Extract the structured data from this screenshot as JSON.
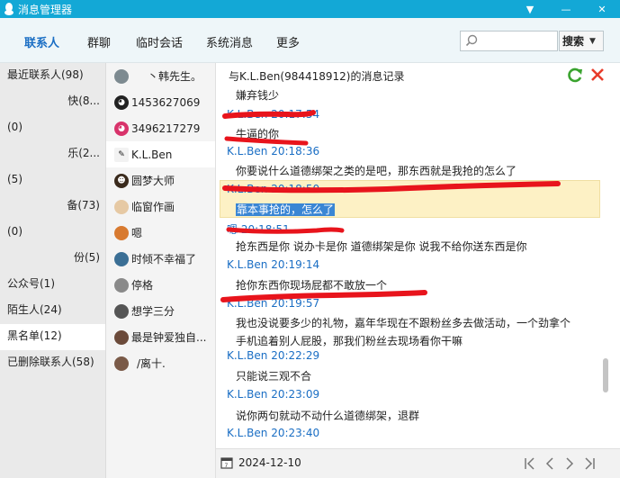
{
  "window": {
    "title": "消息管理器",
    "buttons": [
      "▼",
      "—",
      "✕"
    ]
  },
  "nav": {
    "tabs": [
      "联系人",
      "群聊",
      "临时会话",
      "系统消息",
      "更多"
    ],
    "active": 0
  },
  "search": {
    "placeholder": "",
    "button_label": "搜索"
  },
  "categories": [
    {
      "label": "最近联系人(98)"
    },
    {
      "label": "快(8..."
    },
    {
      "label": "(0)"
    },
    {
      "label": "乐(2..."
    },
    {
      "label": "(5)"
    },
    {
      "label": "备(73)"
    },
    {
      "label": "(0)"
    },
    {
      "label": "份(5)"
    },
    {
      "label": "公众号(1)"
    },
    {
      "label": "陌生人(24)"
    },
    {
      "label": "黑名单(12)"
    },
    {
      "label": "已删除联系人(58)"
    }
  ],
  "contacts": [
    {
      "name": "丶韩先生。"
    },
    {
      "name": "1453627069"
    },
    {
      "name": "3496217279"
    },
    {
      "name": "K.L.Ben"
    },
    {
      "name": "圆梦大师"
    },
    {
      "name": "临窗作画"
    },
    {
      "name": "嗯"
    },
    {
      "name": "时倾不幸福了"
    },
    {
      "name": "停格"
    },
    {
      "name": "想学三分"
    },
    {
      "name": "最是钟爱独自..."
    },
    {
      "name": "/离十."
    }
  ],
  "record": {
    "title": "与K.L.Ben(984418912)的消息记录",
    "items": [
      {
        "kind": "msg",
        "text": "嫌弃钱少"
      },
      {
        "kind": "meta",
        "text": "K.L.Ben 20:17:54"
      },
      {
        "kind": "msg",
        "text": "牛逼的你"
      },
      {
        "kind": "meta",
        "text": "K.L.Ben 20:18:36"
      },
      {
        "kind": "msg",
        "text": "你要说什么道德绑架之类的是吧，那东西就是我抢的怎么了"
      },
      {
        "kind": "meta",
        "text": "K.L.Ben 20:18:50"
      },
      {
        "kind": "msg",
        "text": "靠本事抢的，怎么了"
      },
      {
        "kind": "meta",
        "text": "嗯 20:18:51"
      },
      {
        "kind": "msg",
        "text": "抢东西是你   说办卡是你   道德绑架是你   说我不给你送东西是你"
      },
      {
        "kind": "meta",
        "text": "K.L.Ben 20:19:14"
      },
      {
        "kind": "msg",
        "text": "抢你东西你现场屁都不敢放一个"
      },
      {
        "kind": "meta",
        "text": "K.L.Ben 20:19:57"
      },
      {
        "kind": "msg",
        "text": "我也没说要多少的礼物，嘉年华现在不跟粉丝多去做活动，一个劲拿个"
      },
      {
        "kind": "msg",
        "text": "手机追着别人屁股，那我们粉丝去现场看你干嘛"
      },
      {
        "kind": "meta",
        "text": "K.L.Ben 20:22:29"
      },
      {
        "kind": "msg",
        "text": "只能说三观不合"
      },
      {
        "kind": "meta",
        "text": "K.L.Ben 20:23:09"
      },
      {
        "kind": "msg",
        "text": "说你两句就动不动什么道德绑架，退群"
      },
      {
        "kind": "meta",
        "text": "K.L.Ben 20:23:40"
      }
    ]
  },
  "footer": {
    "date": "2024-12-10"
  },
  "colors": {
    "titlebar": "#13a8d6",
    "link_blue": "#1a6ec4",
    "highlight": "#fdf1c5",
    "selection": "#3a86d4",
    "redline": "#e8141c"
  }
}
